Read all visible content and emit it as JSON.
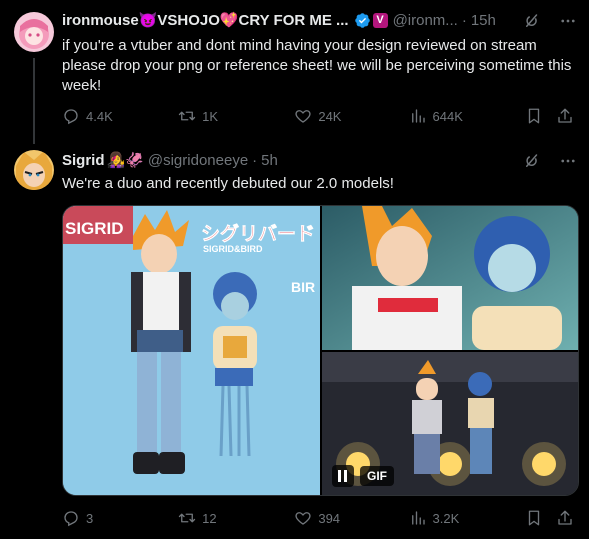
{
  "tweet1": {
    "display_name": "ironmouse😈VSHOJO💖CRY FOR ME ...",
    "name_prefix_emoji": "💖",
    "badge_letter": "V",
    "handle": "@ironm...",
    "separator": "·",
    "time": "15h",
    "text": "if you're a vtuber and dont mind having your design reviewed on stream please drop your png or reference sheet! we will be perceiving sometime this week!",
    "stats": {
      "replies": "4.4K",
      "reposts": "1K",
      "likes": "24K",
      "views": "644K"
    }
  },
  "tweet2": {
    "display_name": "Sigrid",
    "name_emojis": "👩‍🎤🦑",
    "handle": "@sigridoneeye",
    "separator": "·",
    "time": "5h",
    "text": "We're a duo and recently debuted our 2.0 models!",
    "media": {
      "gif_label": "GIF",
      "left_art_title": "SIGRID",
      "left_art_logo": "シグリバード",
      "left_art_logo_sub": "SIGRID&BIRD",
      "left_art_side": "BIR"
    },
    "stats": {
      "replies": "3",
      "reposts": "12",
      "likes": "394",
      "views": "3.2K"
    }
  },
  "colors": {
    "background": "#000000",
    "text": "#e7e9ea",
    "muted": "#71767b",
    "verified": "#1d9bf0",
    "thread_line": "#333639"
  },
  "icons": [
    "grok-icon",
    "more-icon",
    "reply-icon",
    "repost-icon",
    "like-icon",
    "views-icon",
    "bookmark-icon",
    "share-icon",
    "verified-icon",
    "pause-icon"
  ]
}
